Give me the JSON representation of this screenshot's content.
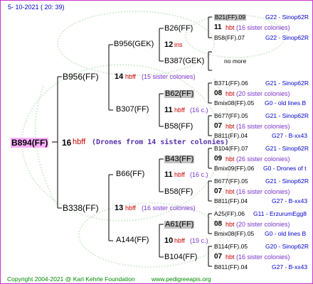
{
  "header": {
    "date": "5- 10-2021 ( 20: 39)"
  },
  "footer": {
    "copyright": "Copyright 2004-2021 @ Karl Kehrle Foundation",
    "website": "www.pedigreeapis.org"
  },
  "colors": {
    "accent": "#cc33cc",
    "link": "#0000cc",
    "hbbf": "#cc0000",
    "sister": "#7a33cc",
    "footer": "#008800",
    "highlight": "#ffb0ff",
    "grey_box": "#c0c0c0"
  },
  "root": {
    "name": "B894(FF)",
    "num": "16",
    "hbbf": "hbff",
    "note": "(Drones from 14 sister colonies)"
  },
  "gen1": [
    {
      "name": "B956(FF)",
      "num": "14",
      "hbbf": "hbff",
      "note": "(15 sister colonies)"
    },
    {
      "name": "B338(FF)",
      "num": "13",
      "hbbf": "hbff",
      "note": "(16 sister colonies)"
    }
  ],
  "gen2": [
    {
      "name": "B956(GEK)",
      "num": "12",
      "hbbf": "ins",
      "note": ""
    },
    {
      "name": "B307(FF)",
      "num": "11",
      "hbbf": "hbff",
      "note": "(16 c.)"
    },
    {
      "name": "B66(FF)",
      "num": "11",
      "hbbf": "hbff",
      "note": "(16 c.)"
    },
    {
      "name": "A144(FF)",
      "num": "10",
      "hbbf": "hbff",
      "note": "(19 c.)"
    }
  ],
  "gen3": [
    {
      "name": "B26(FF)"
    },
    {
      "name": "B387(GEK)"
    },
    {
      "name": "B62(FF)"
    },
    {
      "name": "B58(FF)"
    },
    {
      "name": "B43(FF)"
    },
    {
      "name": "B58(FF)"
    },
    {
      "name": "A61(FF)"
    },
    {
      "name": "B104(FF)"
    }
  ],
  "gen4": [
    {
      "top": "B21(FF).09",
      "top_ref": "G22 - Sinop62R",
      "num": "11",
      "hbbf": "hbt",
      "note": "(16 sister colonies)",
      "bottom": "B58(FF).07",
      "bottom_ref": "G22 - Sinop62R"
    },
    {
      "single": "no more"
    },
    {
      "top": "B371(FF).06",
      "top_ref": "G21 - Sinop62R",
      "num": "08",
      "hbbf": "hbt",
      "note": "(20 sister colonies)",
      "bottom": "Bmix08(FF).05",
      "bottom_ref": "G0 - old lines B"
    },
    {
      "top": "B677(FF).05",
      "top_ref": "G21 - Sinop62R",
      "num": "07",
      "hbbf": "hbt",
      "note": "(16 sister colonies)",
      "bottom": "B811(FF).04",
      "bottom_ref": "G27 - B-xx43"
    },
    {
      "top": "B104(FF).07",
      "top_ref": "G21 - Sinop62R",
      "num": "09",
      "hbbf": "hbt",
      "note": "(26 sister colonies)",
      "bottom": "Bmix09(FF).06",
      "bottom_ref": "G0 - Drones of t"
    },
    {
      "top": "B677(FF).05",
      "top_ref": "G21 - Sinop62R",
      "num": "07",
      "hbbf": "hbt",
      "note": "(16 sister colonies)",
      "bottom": "B811(FF).04",
      "bottom_ref": "G27 - B-xx43"
    },
    {
      "top": "A25(FF).06",
      "top_ref": "G11 - ErzurumEgg8",
      "num": "08",
      "hbbf": "hbt",
      "note": "(20 sister colonies)",
      "bottom": "Bmix08(FF).05",
      "bottom_ref": "G0 - old lines B"
    },
    {
      "top": "B114(FF).05",
      "top_ref": "G20 - Sinop62R",
      "num": "07",
      "hbbf": "hbt",
      "note": "(16 sister colonies)",
      "bottom": "B811(FF).04",
      "bottom_ref": "G27 - B-xx43"
    }
  ]
}
